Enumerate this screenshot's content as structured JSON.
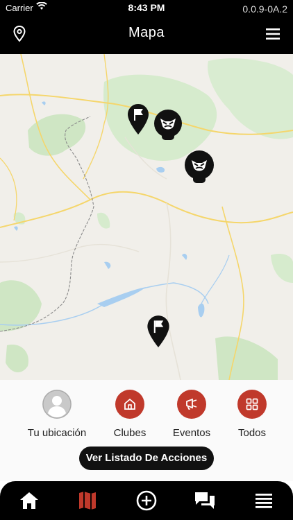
{
  "status": {
    "carrier": "Carrier",
    "time": "8:43 PM",
    "version": "0.0.9-0A.2"
  },
  "nav": {
    "title": "Mapa"
  },
  "map": {
    "pins": [
      {
        "type": "flag"
      },
      {
        "type": "club"
      },
      {
        "type": "club"
      },
      {
        "type": "flag"
      }
    ]
  },
  "filters": [
    {
      "label": "Tu ubicación",
      "icon": "user-avatar-icon"
    },
    {
      "label": "Clubes",
      "icon": "home-icon",
      "color": "#c0392b"
    },
    {
      "label": "Eventos",
      "icon": "megaphone-icon",
      "color": "#c0392b"
    },
    {
      "label": "Todos",
      "icon": "grid-icon",
      "color": "#c0392b"
    }
  ],
  "actions": {
    "list_button": "Ver Listado De Acciones"
  },
  "tabbar": {
    "items": [
      {
        "icon": "home-icon",
        "active": false
      },
      {
        "icon": "map-icon",
        "active": true
      },
      {
        "icon": "add-circle-icon",
        "active": false
      },
      {
        "icon": "chat-icon",
        "active": false
      },
      {
        "icon": "list-icon",
        "active": false
      }
    ],
    "active_color": "#c0392b"
  }
}
